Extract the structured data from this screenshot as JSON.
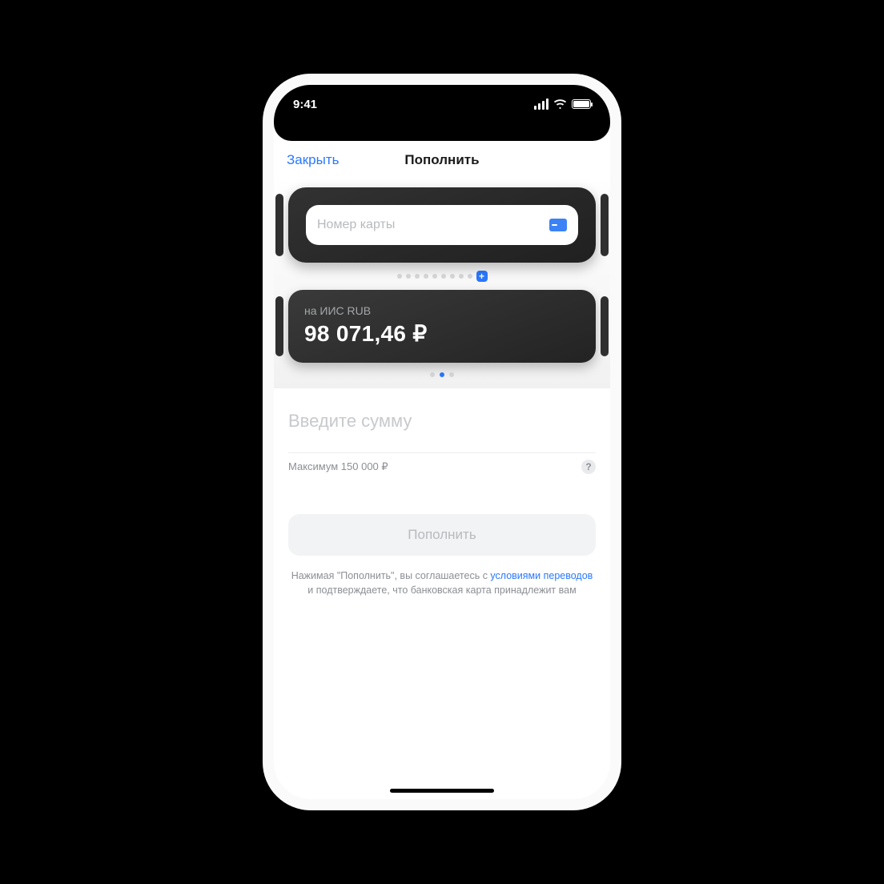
{
  "status": {
    "time": "9:41"
  },
  "nav": {
    "close": "Закрыть",
    "title": "Пополнить"
  },
  "card_input": {
    "placeholder": "Номер карты"
  },
  "account": {
    "label": "на ИИС RUB",
    "balance": "98 071,46 ₽"
  },
  "amount": {
    "placeholder": "Введите сумму",
    "max_hint": "Максимум 150 000 ₽"
  },
  "action": {
    "submit": "Пополнить"
  },
  "legal": {
    "pre": "Нажимая \"Пополнить\", вы соглашаетесь с ",
    "link": "условиями переводов",
    "post": " и подтверждаете, что банковская карта принадлежит вам"
  },
  "help": "?",
  "plus": "+",
  "source_pager_total": 9,
  "dest_pager_total": 3,
  "dest_pager_active_index": 1
}
